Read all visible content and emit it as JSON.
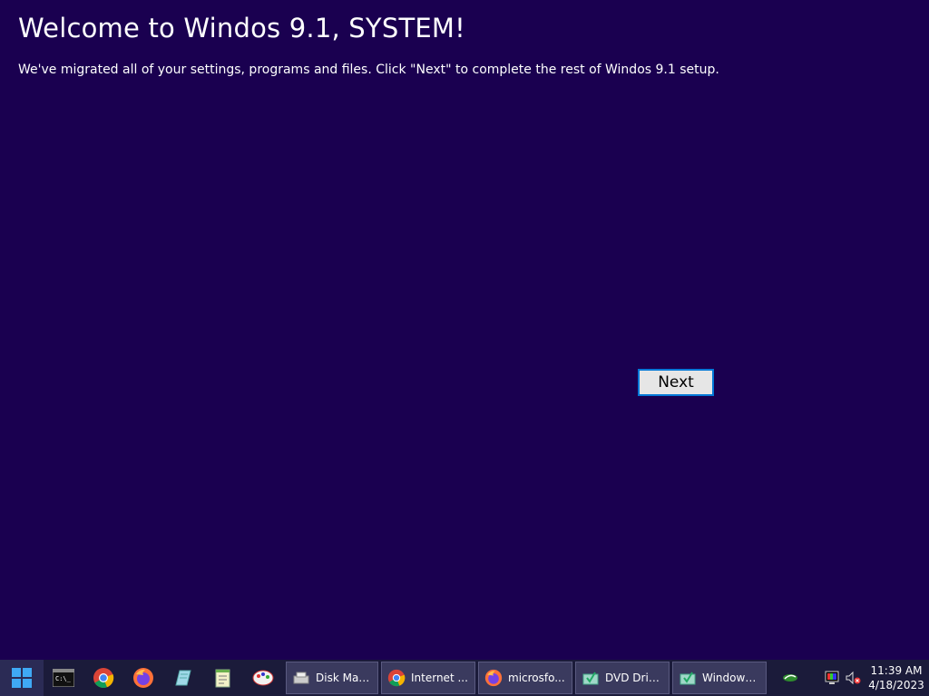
{
  "setup": {
    "title": "Welcome to Windos 9.1, SYSTEM!",
    "subtitle": "We've migrated all of your settings, programs and files. Click \"Next\" to complete the rest of Windos 9.1 setup.",
    "next_label": "Next"
  },
  "taskbar": {
    "pinned": [
      {
        "name": "command-prompt-icon"
      },
      {
        "name": "chrome-icon"
      },
      {
        "name": "firefox-icon"
      },
      {
        "name": "notebook-icon"
      },
      {
        "name": "notepad-icon"
      },
      {
        "name": "paint-icon"
      }
    ],
    "tasks": [
      {
        "label": "Disk Man...",
        "icon": "disk-management-icon"
      },
      {
        "label": "Internet ...",
        "icon": "chrome-icon"
      },
      {
        "label": "microsfo...",
        "icon": "firefox-icon"
      },
      {
        "label": "DVD Driv...",
        "icon": "dvd-drive-icon"
      },
      {
        "label": "Windows...",
        "icon": "windows-setup-icon"
      }
    ],
    "tray": {
      "time": "11:39 AM",
      "date": "4/18/2023"
    }
  },
  "colors": {
    "background": "#1a0050",
    "taskbar": "#1b1b3a",
    "button_border": "#0078d7"
  }
}
